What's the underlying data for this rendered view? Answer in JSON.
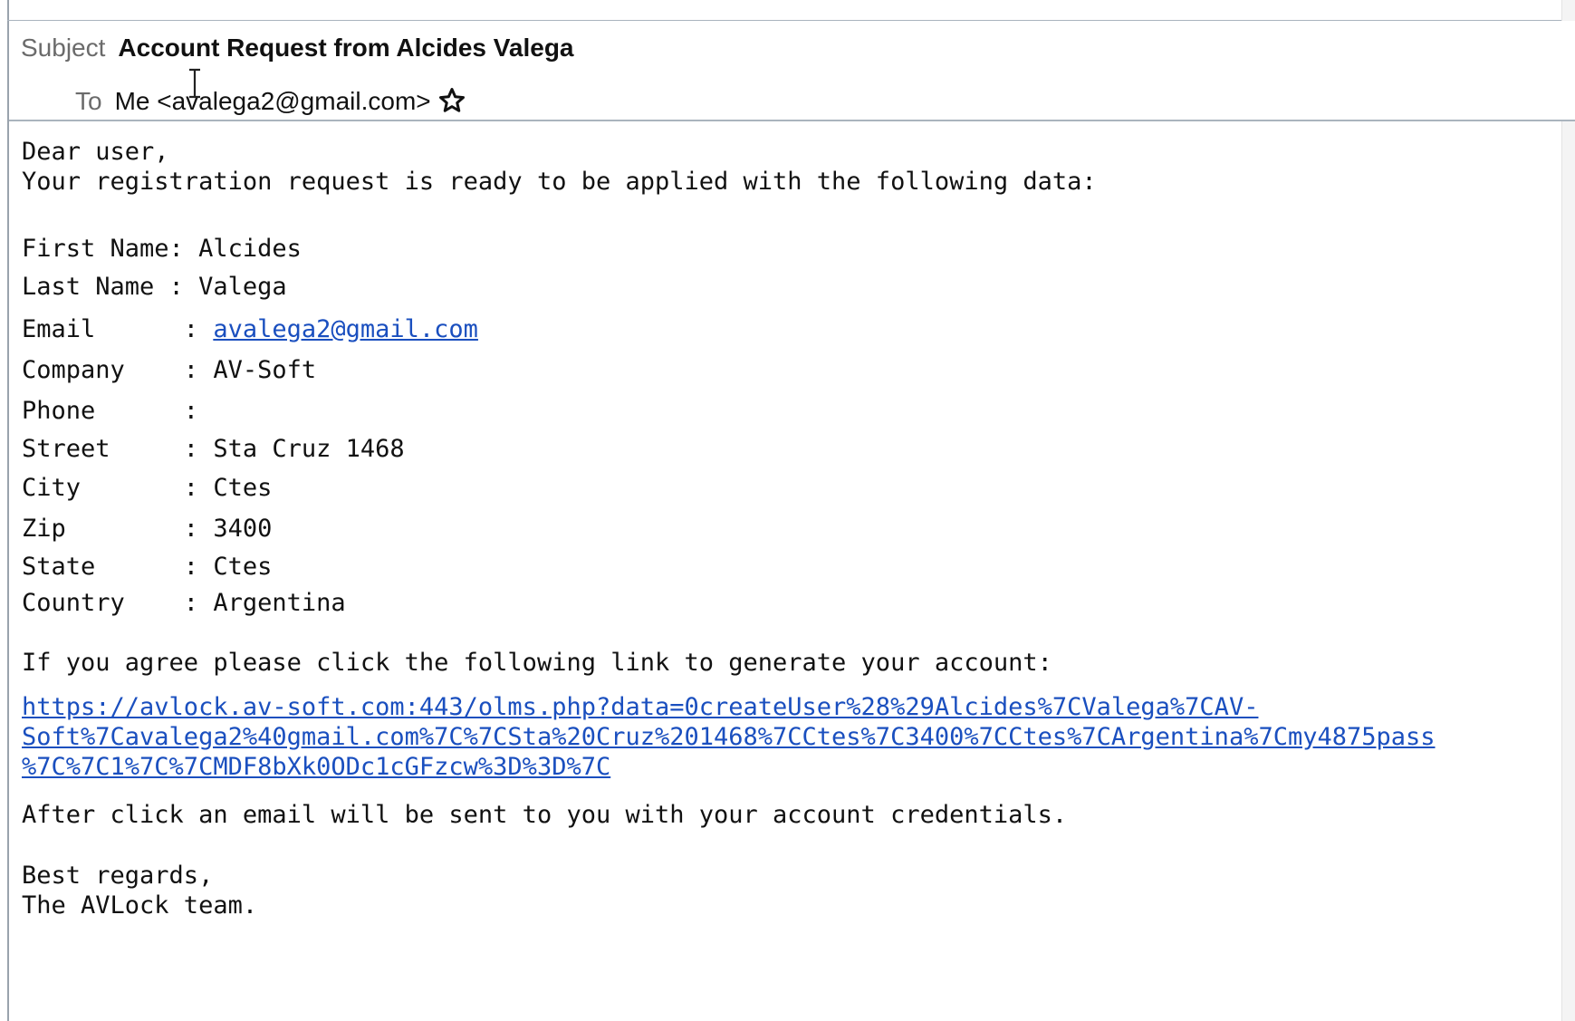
{
  "header": {
    "subject_label": "Subject",
    "subject": "Account Request from Alcides Valega",
    "to_label": "To",
    "to_value": "Me <avalega2@gmail.com>",
    "star_icon": "star-outline-icon"
  },
  "body": {
    "greeting": "Dear user,",
    "intro": "Your registration request is ready to be applied with the following data:",
    "fields": [
      {
        "label": "First Name: ",
        "value": "Alcides"
      },
      {
        "label": "Last Name : ",
        "value": "Valega"
      },
      {
        "label": "Email      : ",
        "value": "avalega2@gmail.com"
      },
      {
        "label": "Company    : ",
        "value": "AV-Soft"
      },
      {
        "label": "Phone      :",
        "value": ""
      },
      {
        "label": "Street     : ",
        "value": "Sta Cruz 1468"
      },
      {
        "label": "City       : ",
        "value": "Ctes"
      },
      {
        "label": "Zip        : ",
        "value": "3400"
      },
      {
        "label": "State      : ",
        "value": "Ctes"
      },
      {
        "label": "Country    : ",
        "value": "Argentina"
      }
    ],
    "agree_text": "If you agree please click the following link to generate your account:",
    "link_line1": "https://avlock.av-soft.com:443/olms.php?data=0createUser%28%29Alcides%7CValega%7CAV-",
    "link_line2": "Soft%7Cavalega2%40gmail.com%7C%7CSta%20Cruz%201468%7CCtes%7C3400%7CCtes%7CArgentina%7Cmy4875pass",
    "link_line3": "%7C%7C1%7C%7CMDF8bXk0ODc1cGFzcw%3D%3D%7C",
    "after_text": "After click an email will be sent to you with your account credentials.",
    "regards": "Best regards,",
    "signature": "The AVLock team."
  }
}
